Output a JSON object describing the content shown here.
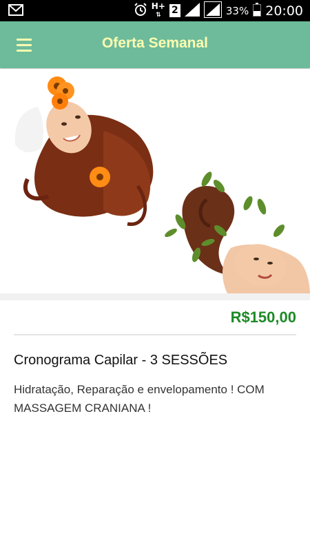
{
  "status_bar": {
    "network_label": "H+",
    "sim_slot": "2",
    "battery_percent": "33%",
    "time": "20:00"
  },
  "app_bar": {
    "title": "Oferta Semanal",
    "menu_icon": "hamburger-menu-icon"
  },
  "offer": {
    "price": "R$150,00",
    "title": "Cronograma Capilar - 3 SESSÕES",
    "description": "Hidratação, Reparação e envelopamento ! COM MASSAGEM CRANIANA !"
  },
  "colors": {
    "app_bar": "#6dbb9b",
    "app_bar_text": "#fdfcb0",
    "price": "#1e8a26"
  }
}
